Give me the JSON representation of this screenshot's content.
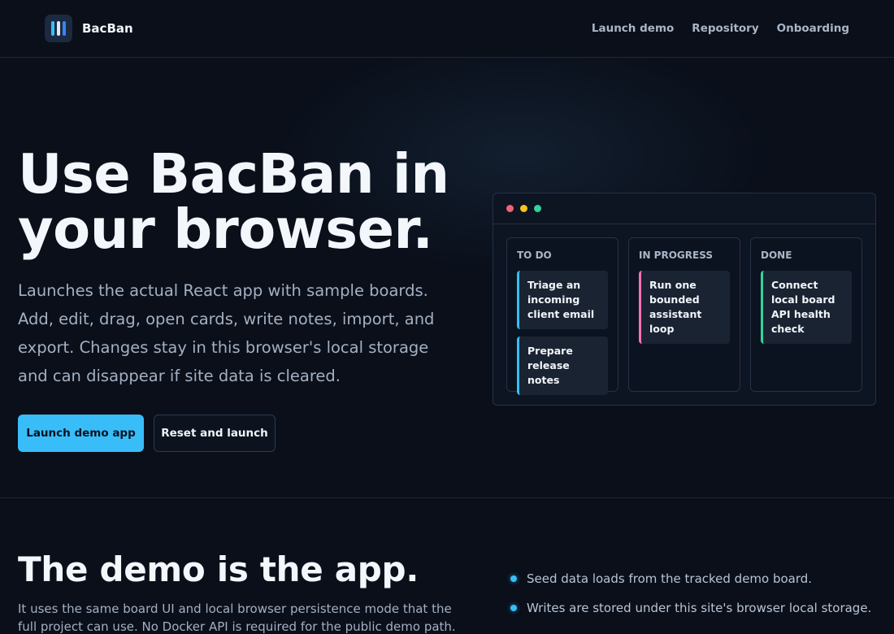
{
  "brand": {
    "name": "BacBan"
  },
  "nav": {
    "items": [
      {
        "label": "Launch demo"
      },
      {
        "label": "Repository"
      },
      {
        "label": "Onboarding"
      }
    ]
  },
  "hero": {
    "title_line1": "Use BacBan in",
    "title_line2": "your browser.",
    "description": "Launches the actual React app with sample boards. Add, edit, drag, open cards, write notes, import, and export. Changes stay in this browser's local storage and can disappear if site data is cleared.",
    "primary_button": "Launch demo app",
    "secondary_button": "Reset and launch"
  },
  "board": {
    "columns": [
      {
        "title": "TO DO",
        "cards": [
          "Triage an incoming client email",
          "Prepare release notes"
        ]
      },
      {
        "title": "IN PROGRESS",
        "cards": [
          "Run one bounded assistant loop"
        ]
      },
      {
        "title": "DONE",
        "cards": [
          "Connect local board API health check"
        ]
      }
    ]
  },
  "demo": {
    "title": "The demo is the app.",
    "text": "It uses the same board UI and local browser persistence mode that the full project can use. No Docker API is required for the public demo path.",
    "bullets": [
      "Seed data loads from the tracked demo board.",
      "Writes are stored under this site's browser local storage."
    ]
  },
  "colors": {
    "accent": "#38bdf8",
    "background": "#0a0f1a",
    "todo_card_accent": "#38bdf8",
    "in_progress_card_accent": "#f472b6",
    "done_card_accent": "#34d399"
  }
}
